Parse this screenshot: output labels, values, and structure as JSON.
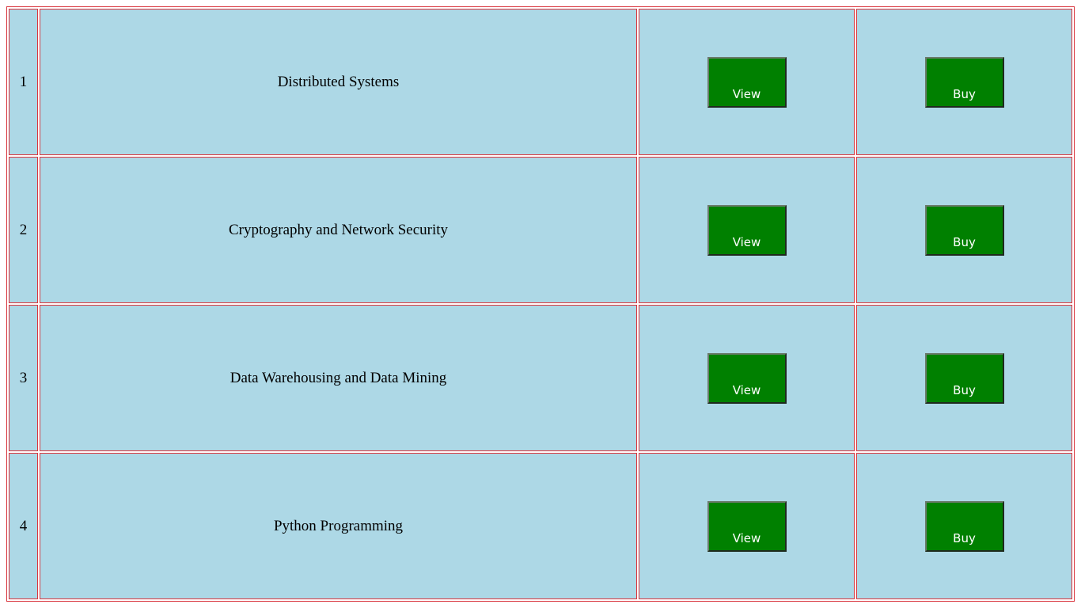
{
  "table": {
    "rows": [
      {
        "num": "1",
        "title": "Distributed Systems",
        "view_label": "View",
        "buy_label": "Buy"
      },
      {
        "num": "2",
        "title": "Cryptography and Network Security",
        "view_label": "View",
        "buy_label": "Buy"
      },
      {
        "num": "3",
        "title": "Data Warehousing and Data Mining",
        "view_label": "View",
        "buy_label": "Buy"
      },
      {
        "num": "4",
        "title": "Python Programming",
        "view_label": "View",
        "buy_label": "Buy"
      }
    ]
  },
  "colors": {
    "cell_background": "#add8e6",
    "border": "#d9353d",
    "button_background": "#008000",
    "button_text": "#ffffff"
  }
}
